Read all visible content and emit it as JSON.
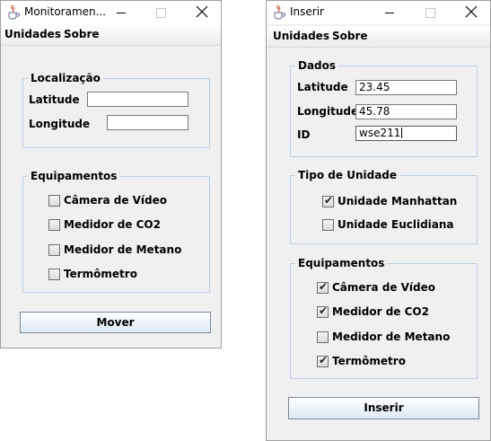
{
  "main_window": {
    "title": "Monitoramen...",
    "menu": [
      "Unidades",
      "Sobre"
    ],
    "location_group": {
      "legend": "Localização",
      "latitude_label": "Latitude",
      "latitude_value": "",
      "longitude_label": "Longitude",
      "longitude_value": ""
    },
    "equipment_group": {
      "legend": "Equipamentos",
      "items": [
        {
          "label": "Câmera de Vídeo",
          "checked": false
        },
        {
          "label": "Medidor de CO2",
          "checked": false
        },
        {
          "label": "Medidor de Metano",
          "checked": false
        },
        {
          "label": "Termômetro",
          "checked": false
        }
      ]
    },
    "move_button": "Mover"
  },
  "insert_window": {
    "title": "Inserir",
    "menu": [
      "Unidades",
      "Sobre"
    ],
    "data_group": {
      "legend": "Dados",
      "latitude_label": "Latitude",
      "latitude_value": "23.45",
      "longitude_label": "Longitude",
      "longitude_value": "45.78",
      "id_label": "ID",
      "id_value": "wse211"
    },
    "unit_type_group": {
      "legend": "Tipo de Unidade",
      "items": [
        {
          "label": "Unidade Manhattan",
          "checked": true
        },
        {
          "label": "Unidade Euclidiana",
          "checked": false
        }
      ]
    },
    "equipment_group": {
      "legend": "Equipamentos",
      "items": [
        {
          "label": "Câmera de Vídeo",
          "checked": true
        },
        {
          "label": "Medidor de CO2",
          "checked": true
        },
        {
          "label": "Medidor de Metano",
          "checked": false
        },
        {
          "label": "Termômetro",
          "checked": true
        }
      ]
    },
    "insert_button": "Inserir"
  },
  "icons": {
    "app": "java-cup-icon",
    "minimize": "minimize-icon",
    "maximize": "maximize-icon",
    "close": "close-icon"
  },
  "colors": {
    "window_bg": "#f0f0f0",
    "group_border": "#b8cfe5",
    "button_gradient_end": "#dde8f4"
  }
}
